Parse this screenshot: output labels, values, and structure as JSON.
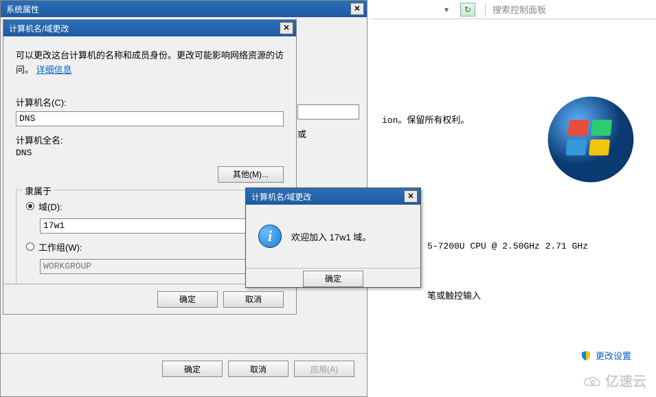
{
  "sysprops": {
    "title": "系统属性",
    "ok": "确定",
    "cancel": "取消",
    "apply": "应用(A)"
  },
  "rename": {
    "title": "计算机名/域更改",
    "desc_prefix": "可以更改这台计算机的名称和成员身份。更改可能影响网络资源的访问。",
    "desc_link": "详细信息",
    "name_label": "计算机名(C):",
    "name_value": "DNS",
    "fullname_label": "计算机全名:",
    "fullname_value": "DNS",
    "other_btn": "其他(M)...",
    "member_legend": "隶属于",
    "domain_label": "域(D):",
    "domain_value": "17w1",
    "workgroup_label": "工作组(W):",
    "workgroup_value": "WORKGROUP",
    "ok": "确定",
    "cancel": "取消",
    "hidden_or": "或"
  },
  "msgbox": {
    "title": "计算机名/域更改",
    "text": "欢迎加入 17w1 域。",
    "ok": "确定",
    "icon": "info-icon"
  },
  "panel": {
    "search_placeholder": "搜索控制面板",
    "rights_suffix": "ion。保留所有权利。",
    "cpu": "5-7200U CPU @ 2.50GHz   2.71 GHz",
    "touch": "笔或触控输入",
    "change_settings": "更改设置",
    "refresh_icon": "refresh-icon",
    "nav_icon": "chevron-down-icon"
  },
  "watermark": "亿速云"
}
